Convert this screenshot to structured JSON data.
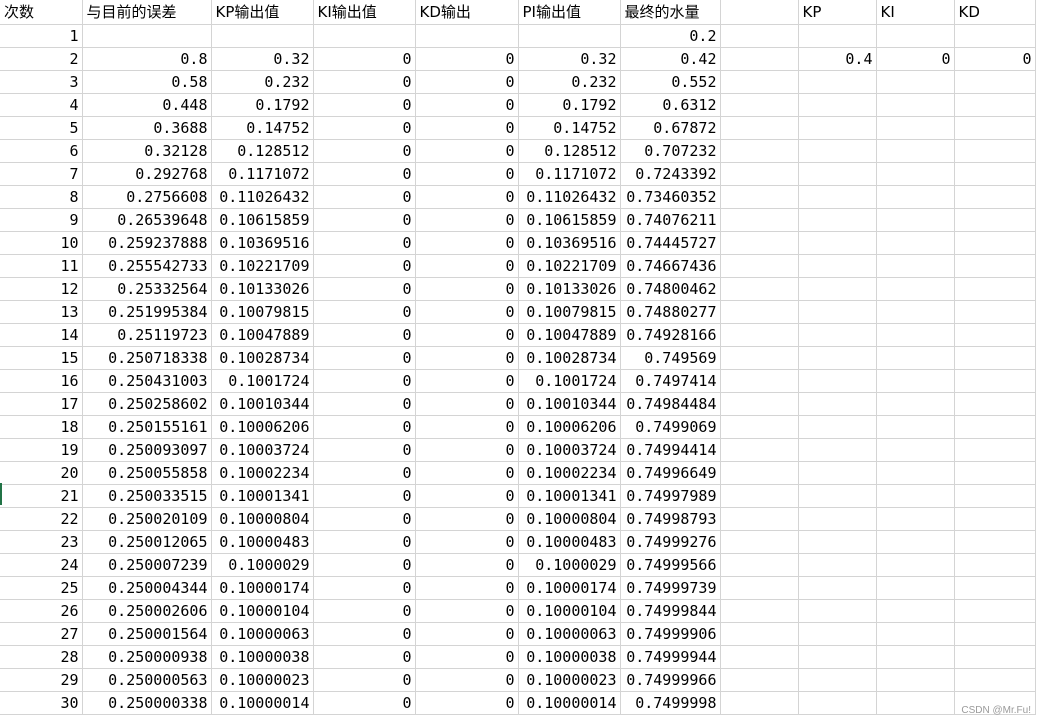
{
  "headers": [
    "次数",
    "与目前的误差",
    "KP输出值",
    "KI输出值",
    "KD输出",
    "PI输出值",
    "最终的水量",
    "",
    "KP",
    "KI",
    "KD"
  ],
  "rows": [
    [
      "1",
      "",
      "",
      "",
      "",
      "",
      "0.2",
      "",
      "",
      "",
      ""
    ],
    [
      "2",
      "0.8",
      "0.32",
      "0",
      "0",
      "0.32",
      "0.42",
      "",
      "0.4",
      "0",
      "0"
    ],
    [
      "3",
      "0.58",
      "0.232",
      "0",
      "0",
      "0.232",
      "0.552",
      "",
      "",
      "",
      ""
    ],
    [
      "4",
      "0.448",
      "0.1792",
      "0",
      "0",
      "0.1792",
      "0.6312",
      "",
      "",
      "",
      ""
    ],
    [
      "5",
      "0.3688",
      "0.14752",
      "0",
      "0",
      "0.14752",
      "0.67872",
      "",
      "",
      "",
      ""
    ],
    [
      "6",
      "0.32128",
      "0.128512",
      "0",
      "0",
      "0.128512",
      "0.707232",
      "",
      "",
      "",
      ""
    ],
    [
      "7",
      "0.292768",
      "0.1171072",
      "0",
      "0",
      "0.1171072",
      "0.7243392",
      "",
      "",
      "",
      ""
    ],
    [
      "8",
      "0.2756608",
      "0.11026432",
      "0",
      "0",
      "0.11026432",
      "0.73460352",
      "",
      "",
      "",
      ""
    ],
    [
      "9",
      "0.26539648",
      "0.10615859",
      "0",
      "0",
      "0.10615859",
      "0.74076211",
      "",
      "",
      "",
      ""
    ],
    [
      "10",
      "0.259237888",
      "0.10369516",
      "0",
      "0",
      "0.10369516",
      "0.74445727",
      "",
      "",
      "",
      ""
    ],
    [
      "11",
      "0.255542733",
      "0.10221709",
      "0",
      "0",
      "0.10221709",
      "0.74667436",
      "",
      "",
      "",
      ""
    ],
    [
      "12",
      "0.25332564",
      "0.10133026",
      "0",
      "0",
      "0.10133026",
      "0.74800462",
      "",
      "",
      "",
      ""
    ],
    [
      "13",
      "0.251995384",
      "0.10079815",
      "0",
      "0",
      "0.10079815",
      "0.74880277",
      "",
      "",
      "",
      ""
    ],
    [
      "14",
      "0.25119723",
      "0.10047889",
      "0",
      "0",
      "0.10047889",
      "0.74928166",
      "",
      "",
      "",
      ""
    ],
    [
      "15",
      "0.250718338",
      "0.10028734",
      "0",
      "0",
      "0.10028734",
      "0.749569",
      "",
      "",
      "",
      ""
    ],
    [
      "16",
      "0.250431003",
      "0.1001724",
      "0",
      "0",
      "0.1001724",
      "0.7497414",
      "",
      "",
      "",
      ""
    ],
    [
      "17",
      "0.250258602",
      "0.10010344",
      "0",
      "0",
      "0.10010344",
      "0.74984484",
      "",
      "",
      "",
      ""
    ],
    [
      "18",
      "0.250155161",
      "0.10006206",
      "0",
      "0",
      "0.10006206",
      "0.7499069",
      "",
      "",
      "",
      ""
    ],
    [
      "19",
      "0.250093097",
      "0.10003724",
      "0",
      "0",
      "0.10003724",
      "0.74994414",
      "",
      "",
      "",
      ""
    ],
    [
      "20",
      "0.250055858",
      "0.10002234",
      "0",
      "0",
      "0.10002234",
      "0.74996649",
      "",
      "",
      "",
      ""
    ],
    [
      "21",
      "0.250033515",
      "0.10001341",
      "0",
      "0",
      "0.10001341",
      "0.74997989",
      "",
      "",
      "",
      ""
    ],
    [
      "22",
      "0.250020109",
      "0.10000804",
      "0",
      "0",
      "0.10000804",
      "0.74998793",
      "",
      "",
      "",
      ""
    ],
    [
      "23",
      "0.250012065",
      "0.10000483",
      "0",
      "0",
      "0.10000483",
      "0.74999276",
      "",
      "",
      "",
      ""
    ],
    [
      "24",
      "0.250007239",
      "0.1000029",
      "0",
      "0",
      "0.1000029",
      "0.74999566",
      "",
      "",
      "",
      ""
    ],
    [
      "25",
      "0.250004344",
      "0.10000174",
      "0",
      "0",
      "0.10000174",
      "0.74999739",
      "",
      "",
      "",
      ""
    ],
    [
      "26",
      "0.250002606",
      "0.10000104",
      "0",
      "0",
      "0.10000104",
      "0.74999844",
      "",
      "",
      "",
      ""
    ],
    [
      "27",
      "0.250001564",
      "0.10000063",
      "0",
      "0",
      "0.10000063",
      "0.74999906",
      "",
      "",
      "",
      ""
    ],
    [
      "28",
      "0.250000938",
      "0.10000038",
      "0",
      "0",
      "0.10000038",
      "0.74999944",
      "",
      "",
      "",
      ""
    ],
    [
      "29",
      "0.250000563",
      "0.10000023",
      "0",
      "0",
      "0.10000023",
      "0.74999966",
      "",
      "",
      "",
      ""
    ],
    [
      "30",
      "0.250000338",
      "0.10000014",
      "0",
      "0",
      "0.10000014",
      "0.7499998",
      "",
      "",
      "",
      ""
    ]
  ],
  "watermark": "CSDN @Mr.Fu!",
  "colors": {
    "gridline": "#d4d4d4",
    "active_row_marker": "#217346",
    "watermark": "#9a9a9a"
  }
}
